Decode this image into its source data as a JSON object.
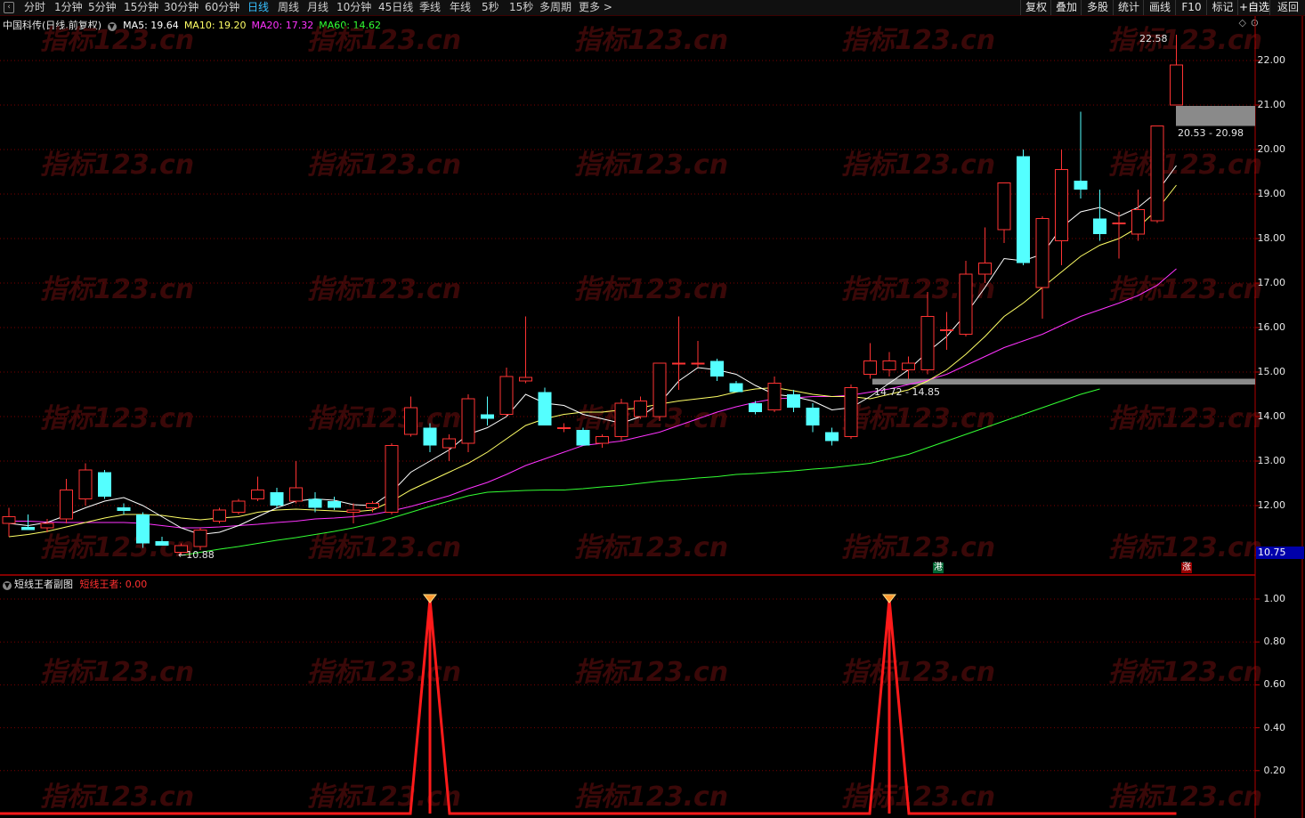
{
  "toolbar": {
    "periods": [
      "分时",
      "1分钟",
      "5分钟",
      "15分钟",
      "30分钟",
      "60分钟",
      "日线",
      "周线",
      "月线",
      "10分钟",
      "45日线",
      "季线",
      "年线",
      "5秒",
      "15秒",
      "多周期",
      "更多 >"
    ],
    "active_period": "日线",
    "right_buttons": [
      "复权",
      "叠加",
      "多股",
      "统计",
      "画线",
      "F10",
      "标记",
      "+自选",
      "返回"
    ]
  },
  "stock": {
    "name": "中国科传",
    "mode": "(日线,前复权)",
    "ma": [
      {
        "label": "MA5: 19.64",
        "color": "#ffffff"
      },
      {
        "label": "MA10: 19.20",
        "color": "#ffff66"
      },
      {
        "label": "MA20: 17.32",
        "color": "#ff33ff"
      },
      {
        "label": "MA60: 14.62",
        "color": "#33ff33"
      }
    ]
  },
  "main_axis": {
    "labels": [
      "22.00",
      "21.00",
      "20.00",
      "19.00",
      "18.00",
      "17.00",
      "16.00",
      "15.00",
      "14.00",
      "13.00",
      "12.00"
    ],
    "current_price": "10.75"
  },
  "annotations": {
    "high": "22.58",
    "low": "10.88",
    "gap_upper": "20.53 - 20.98",
    "gap_lower": "14.72 - 14.85",
    "tag_hk": "港",
    "tag_up": "涨"
  },
  "sub_chart": {
    "name": "短线王者副图",
    "indicator": "短线王者: 0.00",
    "axis": [
      "1.00",
      "0.80",
      "0.60",
      "0.40",
      "0.20"
    ]
  },
  "watermark": "指标123.cn",
  "colors": {
    "up": "#ff3333",
    "down": "#54ffff",
    "grid": "#7a0000",
    "frame": "#b00000",
    "gap_zone": "#8a8a8a",
    "signal": "#ff1a1a"
  },
  "chart_data": {
    "type": "candlestick",
    "candles": [
      {
        "o": 11.6,
        "h": 11.95,
        "l": 11.3,
        "c": 11.75
      },
      {
        "o": 11.52,
        "h": 11.8,
        "l": 11.45,
        "c": 11.45
      },
      {
        "o": 11.5,
        "h": 11.7,
        "l": 11.4,
        "c": 11.6
      },
      {
        "o": 11.7,
        "h": 12.6,
        "l": 11.6,
        "c": 12.35
      },
      {
        "o": 12.15,
        "h": 12.95,
        "l": 12.0,
        "c": 12.8
      },
      {
        "o": 12.75,
        "h": 12.8,
        "l": 12.15,
        "c": 12.2
      },
      {
        "o": 11.96,
        "h": 12.05,
        "l": 11.8,
        "c": 11.88
      },
      {
        "o": 11.8,
        "h": 11.85,
        "l": 11.05,
        "c": 11.15
      },
      {
        "o": 11.2,
        "h": 11.3,
        "l": 11.1,
        "c": 11.1
      },
      {
        "o": 10.95,
        "h": 11.15,
        "l": 10.88,
        "c": 11.1
      },
      {
        "o": 11.08,
        "h": 11.5,
        "l": 11.0,
        "c": 11.45
      },
      {
        "o": 11.65,
        "h": 11.95,
        "l": 11.6,
        "c": 11.9
      },
      {
        "o": 11.85,
        "h": 12.15,
        "l": 11.8,
        "c": 12.1
      },
      {
        "o": 12.15,
        "h": 12.65,
        "l": 12.1,
        "c": 12.35
      },
      {
        "o": 12.3,
        "h": 12.4,
        "l": 11.95,
        "c": 12.0
      },
      {
        "o": 12.1,
        "h": 13.0,
        "l": 12.05,
        "c": 12.4
      },
      {
        "o": 12.15,
        "h": 12.3,
        "l": 11.85,
        "c": 11.95
      },
      {
        "o": 12.1,
        "h": 12.2,
        "l": 11.9,
        "c": 11.95
      },
      {
        "o": 11.85,
        "h": 12.05,
        "l": 11.6,
        "c": 11.9
      },
      {
        "o": 11.95,
        "h": 12.1,
        "l": 11.85,
        "c": 12.05
      },
      {
        "o": 11.85,
        "h": 13.4,
        "l": 11.8,
        "c": 13.35
      },
      {
        "o": 13.6,
        "h": 14.45,
        "l": 13.55,
        "c": 14.2
      },
      {
        "o": 13.75,
        "h": 13.85,
        "l": 13.2,
        "c": 13.35
      },
      {
        "o": 13.3,
        "h": 13.6,
        "l": 13.0,
        "c": 13.5
      },
      {
        "o": 13.4,
        "h": 14.5,
        "l": 13.2,
        "c": 14.4
      },
      {
        "o": 14.05,
        "h": 14.45,
        "l": 13.8,
        "c": 13.95
      },
      {
        "o": 14.05,
        "h": 15.1,
        "l": 14.0,
        "c": 14.9
      },
      {
        "o": 14.8,
        "h": 16.25,
        "l": 14.75,
        "c": 14.88
      },
      {
        "o": 14.55,
        "h": 14.65,
        "l": 13.8,
        "c": 13.8
      },
      {
        "o": 13.75,
        "h": 13.85,
        "l": 13.65,
        "c": 13.75
      },
      {
        "o": 13.7,
        "h": 13.75,
        "l": 13.35,
        "c": 13.35
      },
      {
        "o": 13.4,
        "h": 13.6,
        "l": 13.3,
        "c": 13.55
      },
      {
        "o": 13.55,
        "h": 14.4,
        "l": 13.45,
        "c": 14.3
      },
      {
        "o": 14.0,
        "h": 14.45,
        "l": 13.95,
        "c": 14.35
      },
      {
        "o": 14.0,
        "h": 15.2,
        "l": 13.9,
        "c": 15.2
      },
      {
        "o": 15.2,
        "h": 16.25,
        "l": 14.6,
        "c": 15.2
      },
      {
        "o": 15.2,
        "h": 15.7,
        "l": 15.1,
        "c": 15.2
      },
      {
        "o": 15.25,
        "h": 15.3,
        "l": 14.8,
        "c": 14.9
      },
      {
        "o": 14.75,
        "h": 14.8,
        "l": 14.55,
        "c": 14.55
      },
      {
        "o": 14.3,
        "h": 14.35,
        "l": 14.05,
        "c": 14.1
      },
      {
        "o": 14.15,
        "h": 14.9,
        "l": 14.1,
        "c": 14.75
      },
      {
        "o": 14.5,
        "h": 14.6,
        "l": 14.1,
        "c": 14.2
      },
      {
        "o": 14.2,
        "h": 14.3,
        "l": 13.65,
        "c": 13.8
      },
      {
        "o": 13.65,
        "h": 13.75,
        "l": 13.35,
        "c": 13.45
      },
      {
        "o": 13.55,
        "h": 14.72,
        "l": 13.5,
        "c": 14.65
      },
      {
        "o": 14.95,
        "h": 15.65,
        "l": 14.85,
        "c": 15.25
      },
      {
        "o": 15.05,
        "h": 15.45,
        "l": 14.9,
        "c": 15.25
      },
      {
        "o": 15.05,
        "h": 15.35,
        "l": 14.85,
        "c": 15.2
      },
      {
        "o": 15.05,
        "h": 16.8,
        "l": 14.95,
        "c": 16.25
      },
      {
        "o": 15.95,
        "h": 16.35,
        "l": 15.5,
        "c": 15.95
      },
      {
        "o": 15.85,
        "h": 17.5,
        "l": 15.8,
        "c": 17.2
      },
      {
        "o": 17.2,
        "h": 18.25,
        "l": 17.0,
        "c": 17.45
      },
      {
        "o": 18.2,
        "h": 19.25,
        "l": 17.9,
        "c": 19.25
      },
      {
        "o": 19.85,
        "h": 20.0,
        "l": 17.4,
        "c": 17.45
      },
      {
        "o": 16.9,
        "h": 18.5,
        "l": 16.2,
        "c": 18.45
      },
      {
        "o": 17.95,
        "h": 20.0,
        "l": 17.4,
        "c": 19.55
      },
      {
        "o": 19.3,
        "h": 20.85,
        "l": 18.9,
        "c": 19.1
      },
      {
        "o": 18.45,
        "h": 19.1,
        "l": 17.95,
        "c": 18.1
      },
      {
        "o": 18.35,
        "h": 18.6,
        "l": 17.55,
        "c": 18.35
      },
      {
        "o": 18.1,
        "h": 19.1,
        "l": 17.95,
        "c": 18.65
      },
      {
        "o": 18.4,
        "h": 20.53,
        "l": 18.35,
        "c": 20.53
      },
      {
        "o": 21.0,
        "h": 22.58,
        "l": 21.0,
        "c": 21.9
      }
    ],
    "ma5": [
      11.6,
      11.55,
      11.62,
      11.78,
      11.95,
      12.1,
      12.18,
      12.0,
      11.75,
      11.5,
      11.35,
      11.4,
      11.55,
      11.75,
      11.95,
      12.1,
      12.15,
      12.12,
      12.02,
      12.0,
      12.3,
      12.75,
      13.0,
      13.25,
      13.6,
      13.75,
      14.0,
      14.5,
      14.3,
      14.25,
      14.05,
      13.95,
      13.85,
      14.0,
      14.3,
      14.8,
      15.1,
      15.05,
      14.95,
      14.7,
      14.5,
      14.45,
      14.35,
      14.15,
      14.2,
      14.45,
      14.75,
      15.05,
      15.45,
      15.8,
      16.3,
      16.9,
      17.55,
      17.5,
      17.65,
      18.25,
      18.6,
      18.7,
      18.5,
      18.7,
      19.05,
      19.64
    ],
    "ma10": [
      11.3,
      11.35,
      11.42,
      11.52,
      11.62,
      11.72,
      11.8,
      11.8,
      11.78,
      11.72,
      11.68,
      11.72,
      11.75,
      11.85,
      11.9,
      11.92,
      11.9,
      11.88,
      11.86,
      11.9,
      12.1,
      12.35,
      12.55,
      12.75,
      12.95,
      13.2,
      13.5,
      13.8,
      13.95,
      14.05,
      14.1,
      14.1,
      14.15,
      14.2,
      14.28,
      14.35,
      14.4,
      14.45,
      14.55,
      14.62,
      14.65,
      14.58,
      14.5,
      14.45,
      14.45,
      14.4,
      14.5,
      14.6,
      14.8,
      15.05,
      15.4,
      15.8,
      16.25,
      16.55,
      16.9,
      17.25,
      17.6,
      17.85,
      18.0,
      18.25,
      18.65,
      19.2
    ],
    "ma20": [
      11.65,
      11.65,
      11.63,
      11.62,
      11.62,
      11.62,
      11.62,
      11.6,
      11.55,
      11.5,
      11.5,
      11.52,
      11.55,
      11.58,
      11.62,
      11.65,
      11.7,
      11.72,
      11.75,
      11.8,
      11.88,
      11.98,
      12.1,
      12.22,
      12.38,
      12.52,
      12.7,
      12.9,
      13.05,
      13.2,
      13.35,
      13.4,
      13.45,
      13.55,
      13.65,
      13.8,
      13.95,
      14.1,
      14.22,
      14.32,
      14.4,
      14.42,
      14.45,
      14.45,
      14.48,
      14.55,
      14.62,
      14.72,
      14.82,
      14.95,
      15.15,
      15.35,
      15.55,
      15.7,
      15.85,
      16.05,
      16.25,
      16.4,
      16.55,
      16.72,
      16.95,
      17.32
    ],
    "ma60_start_index": 9,
    "ma60": [
      10.88,
      10.95,
      11.02,
      11.08,
      11.15,
      11.22,
      11.28,
      11.35,
      11.42,
      11.5,
      11.6,
      11.72,
      11.85,
      11.98,
      12.1,
      12.22,
      12.3,
      12.32,
      12.34,
      12.35,
      12.35,
      12.38,
      12.42,
      12.45,
      12.5,
      12.55,
      12.58,
      12.62,
      12.65,
      12.7,
      12.72,
      12.75,
      12.78,
      12.82,
      12.85,
      12.9,
      12.95,
      13.05,
      13.15,
      13.3,
      13.45,
      13.6,
      13.75,
      13.9,
      14.05,
      14.2,
      14.35,
      14.5,
      14.62
    ],
    "price_gaps": [
      {
        "from": 20.53,
        "to": 20.98
      },
      {
        "from": 14.72,
        "to": 14.85
      }
    ],
    "sub_indicator": {
      "name": "短线王者",
      "peaks_at_index": [
        22,
        46
      ],
      "peak_value": 1.0,
      "base_value": 0.0
    },
    "ylim": [
      10.7,
      22.7
    ]
  }
}
